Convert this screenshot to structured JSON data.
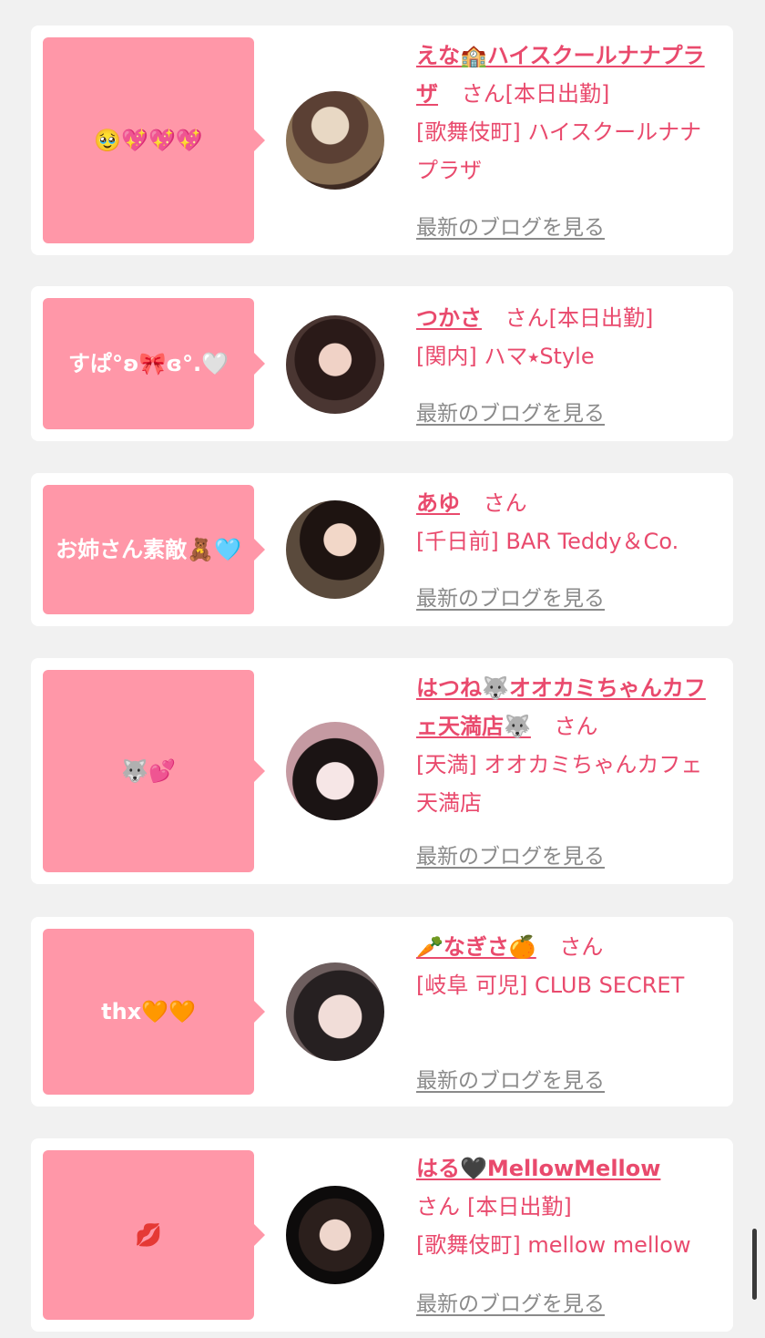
{
  "cards": [
    {
      "comment": "🥹💖💖💖",
      "name": "えな🏫ハイスクールナナプラザ",
      "san": "さん",
      "today": "[本日出勤]",
      "location": "[歌舞伎町] ハイスクールナナプラザ",
      "blog": "最新のブログを見る"
    },
    {
      "comment": "すぱ°ʚ🎀ɞ°.🤍",
      "name": "つかさ",
      "san": "さん",
      "today": "[本日出勤]",
      "location": "[関内] ハマ⭑Style",
      "blog": "最新のブログを見る"
    },
    {
      "comment": "お姉さん素敵🧸🩵",
      "name": "あゆ",
      "san": "さん",
      "today": "",
      "location": "[千日前] BAR Teddy＆Co.",
      "blog": "最新のブログを見る"
    },
    {
      "comment": "🐺💕",
      "name": "はつね🐺オオカミちゃんカフェ天満店🐺",
      "san": "さん",
      "today": "",
      "location": "[天満] オオカミちゃんカフェ天満店",
      "blog": "最新のブログを見る"
    },
    {
      "comment": "thx🧡🧡",
      "name": "🥕なぎさ🍊",
      "san": "さん",
      "today": "",
      "location": "[岐阜 可児] CLUB SECRET",
      "blog": "最新のブログを見る"
    },
    {
      "comment": "💋",
      "name": "はる🖤MellowMellow",
      "san": "さん",
      "today": "[本日出勤]",
      "location": "[歌舞伎町] mellow mellow",
      "blog": "最新のブログを見る"
    }
  ]
}
